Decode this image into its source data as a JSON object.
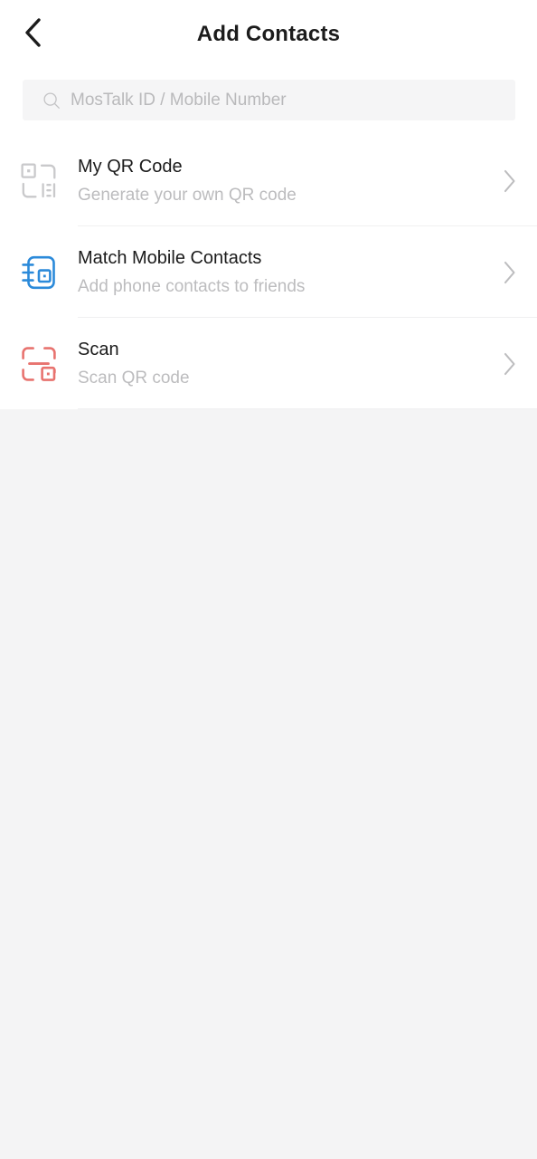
{
  "header": {
    "title": "Add Contacts",
    "back_icon": "chevron-left-icon"
  },
  "search": {
    "placeholder": "MosTalk ID / Mobile Number",
    "value": "",
    "icon": "search-icon"
  },
  "colors": {
    "page_background": "#f4f4f5",
    "sheet_background": "#ffffff",
    "search_background": "#f5f5f6",
    "title_text": "#1c1c1c",
    "row_title_text": "#1b1b1b",
    "row_subtitle_text": "#bcbcbe",
    "divider": "#f0f0f1",
    "chevron": "#bdbdbf",
    "qr_icon": "#c9c9cb",
    "contacts_icon": "#2b8ada",
    "scan_icon": "#e8736f"
  },
  "list": {
    "items": [
      {
        "title": "My QR Code",
        "subtitle": "Generate your own QR code",
        "icon": "my-qr-code-icon",
        "icon_color": "#c9c9cb",
        "chevron": "chevron-right-icon"
      },
      {
        "title": "Match Mobile Contacts",
        "subtitle": "Add phone contacts to friends",
        "icon": "address-book-icon",
        "icon_color": "#2b8ada",
        "chevron": "chevron-right-icon"
      },
      {
        "title": "Scan",
        "subtitle": "Scan QR code",
        "icon": "scan-frame-icon",
        "icon_color": "#e8736f",
        "chevron": "chevron-right-icon"
      }
    ]
  }
}
